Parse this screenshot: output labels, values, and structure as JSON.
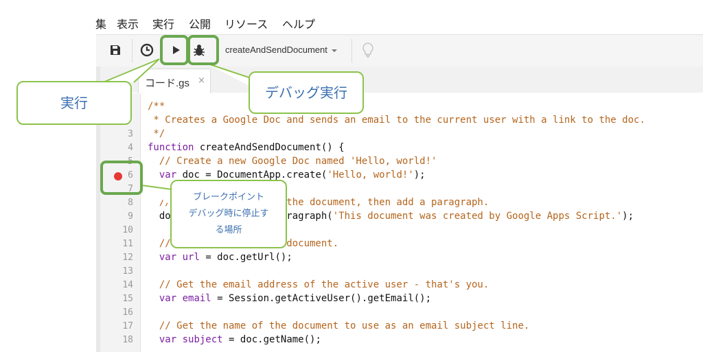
{
  "menu": [
    "集",
    "表示",
    "実行",
    "公開",
    "リソース",
    "ヘルプ"
  ],
  "toolbar": {
    "function_select": "createAndSendDocument",
    "icons": [
      "save-icon",
      "clock-icon",
      "play-icon",
      "bug-icon",
      "lightbulb-icon"
    ]
  },
  "tab": {
    "label": "コード.gs",
    "close": "×"
  },
  "callouts": {
    "run": "実行",
    "debug_run": "デバッグ実行",
    "breakpoint_title": "ブレークポイント",
    "breakpoint_desc1": "デバッグ時に停止す",
    "breakpoint_desc2": "る場所"
  },
  "code_lines": [
    {
      "n": "",
      "parts": [
        [
          "comment",
          "/**"
        ]
      ]
    },
    {
      "n": "",
      "parts": [
        [
          "comment",
          " * Creates a Google Doc and sends an email to the current user with a link to the doc."
        ]
      ]
    },
    {
      "n": "3",
      "parts": [
        [
          "comment",
          " */"
        ]
      ]
    },
    {
      "n": "4",
      "parts": [
        [
          "kw",
          "function"
        ],
        [
          "plain",
          " createAndSendDocument() {"
        ]
      ]
    },
    {
      "n": "5",
      "parts": [
        [
          "comment",
          "  // Create a new Google Doc named 'Hello, world!'"
        ]
      ]
    },
    {
      "n": "6",
      "parts": [
        [
          "plain",
          "  "
        ],
        [
          "kw",
          "var"
        ],
        [
          "plain",
          " doc = DocumentApp.create("
        ],
        [
          "str",
          "'Hello, world!'"
        ],
        [
          "plain",
          ");"
        ]
      ]
    },
    {
      "n": "7",
      "parts": [
        [
          "plain",
          ""
        ]
      ]
    },
    {
      "n": "8",
      "parts": [
        [
          "comment",
          "  // Access the body of the document, then add a paragraph."
        ]
      ]
    },
    {
      "n": "9",
      "parts": [
        [
          "plain",
          "  doc.getBody().appendParagraph("
        ],
        [
          "str",
          "'This document was created by Google Apps Script.'"
        ],
        [
          "plain",
          ");"
        ]
      ]
    },
    {
      "n": "10",
      "parts": [
        [
          "plain",
          ""
        ]
      ]
    },
    {
      "n": "11",
      "parts": [
        [
          "comment",
          "  // Get the URL of the document."
        ]
      ]
    },
    {
      "n": "12",
      "parts": [
        [
          "plain",
          "  "
        ],
        [
          "kw",
          "var"
        ],
        [
          "plain",
          " "
        ],
        [
          "kw",
          "url"
        ],
        [
          "plain",
          " = doc.getUrl();"
        ]
      ]
    },
    {
      "n": "13",
      "parts": [
        [
          "plain",
          ""
        ]
      ]
    },
    {
      "n": "14",
      "parts": [
        [
          "comment",
          "  // Get the email address of the active user - that's you."
        ]
      ]
    },
    {
      "n": "15",
      "parts": [
        [
          "plain",
          "  "
        ],
        [
          "kw",
          "var"
        ],
        [
          "plain",
          " "
        ],
        [
          "kw",
          "email"
        ],
        [
          "plain",
          " = Session.getActiveUser().getEmail();"
        ]
      ]
    },
    {
      "n": "16",
      "parts": [
        [
          "plain",
          ""
        ]
      ]
    },
    {
      "n": "17",
      "parts": [
        [
          "comment",
          "  // Get the name of the document to use as an email subject line."
        ]
      ]
    },
    {
      "n": "18",
      "parts": [
        [
          "plain",
          "  "
        ],
        [
          "kw",
          "var"
        ],
        [
          "plain",
          " "
        ],
        [
          "kw",
          "subject"
        ],
        [
          "plain",
          " = doc.getName();"
        ]
      ]
    }
  ]
}
